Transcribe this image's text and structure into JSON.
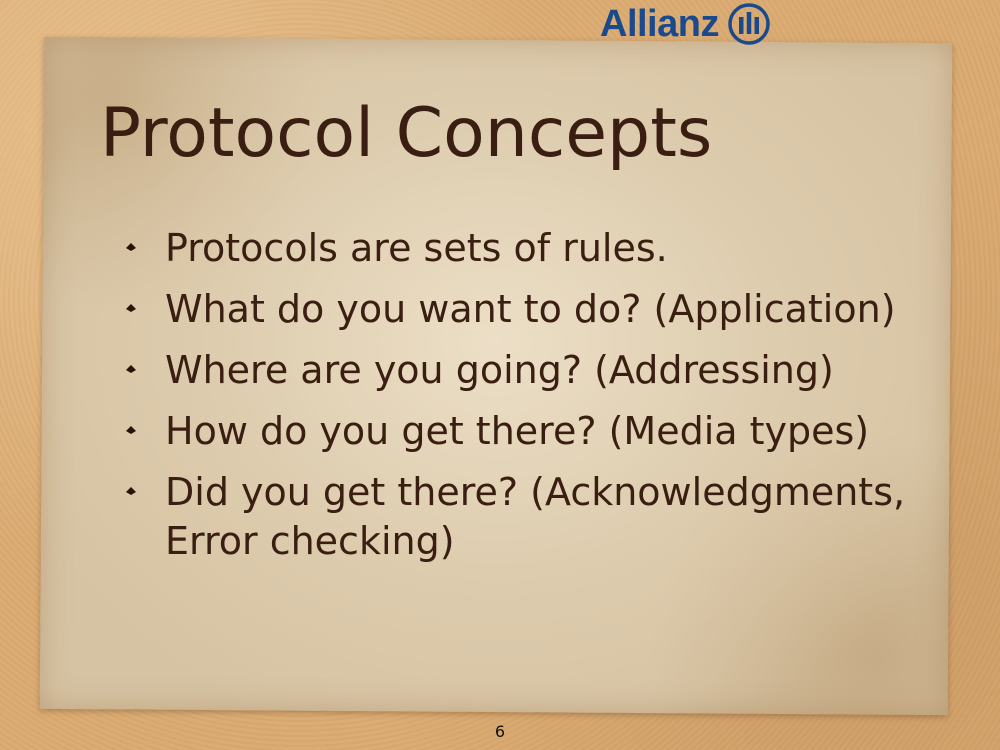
{
  "logo": {
    "text": "Allianz",
    "icon": "allianz-logo-icon",
    "color": "#1a4a8c"
  },
  "slide": {
    "title": "Protocol Concepts",
    "bullet_icon": "diamond-bullet-icon",
    "bullets": [
      "Protocols are sets of rules.",
      "What do you want to do? (Application)",
      "Where are you going? (Addressing)",
      "How do you get there? (Media types)",
      "Did you get there? (Acknowledgments, Error checking)"
    ],
    "page_number": "6"
  },
  "colors": {
    "text": "#3a1e12",
    "paper": "#d6c3a3",
    "background": "#d9aa72"
  }
}
